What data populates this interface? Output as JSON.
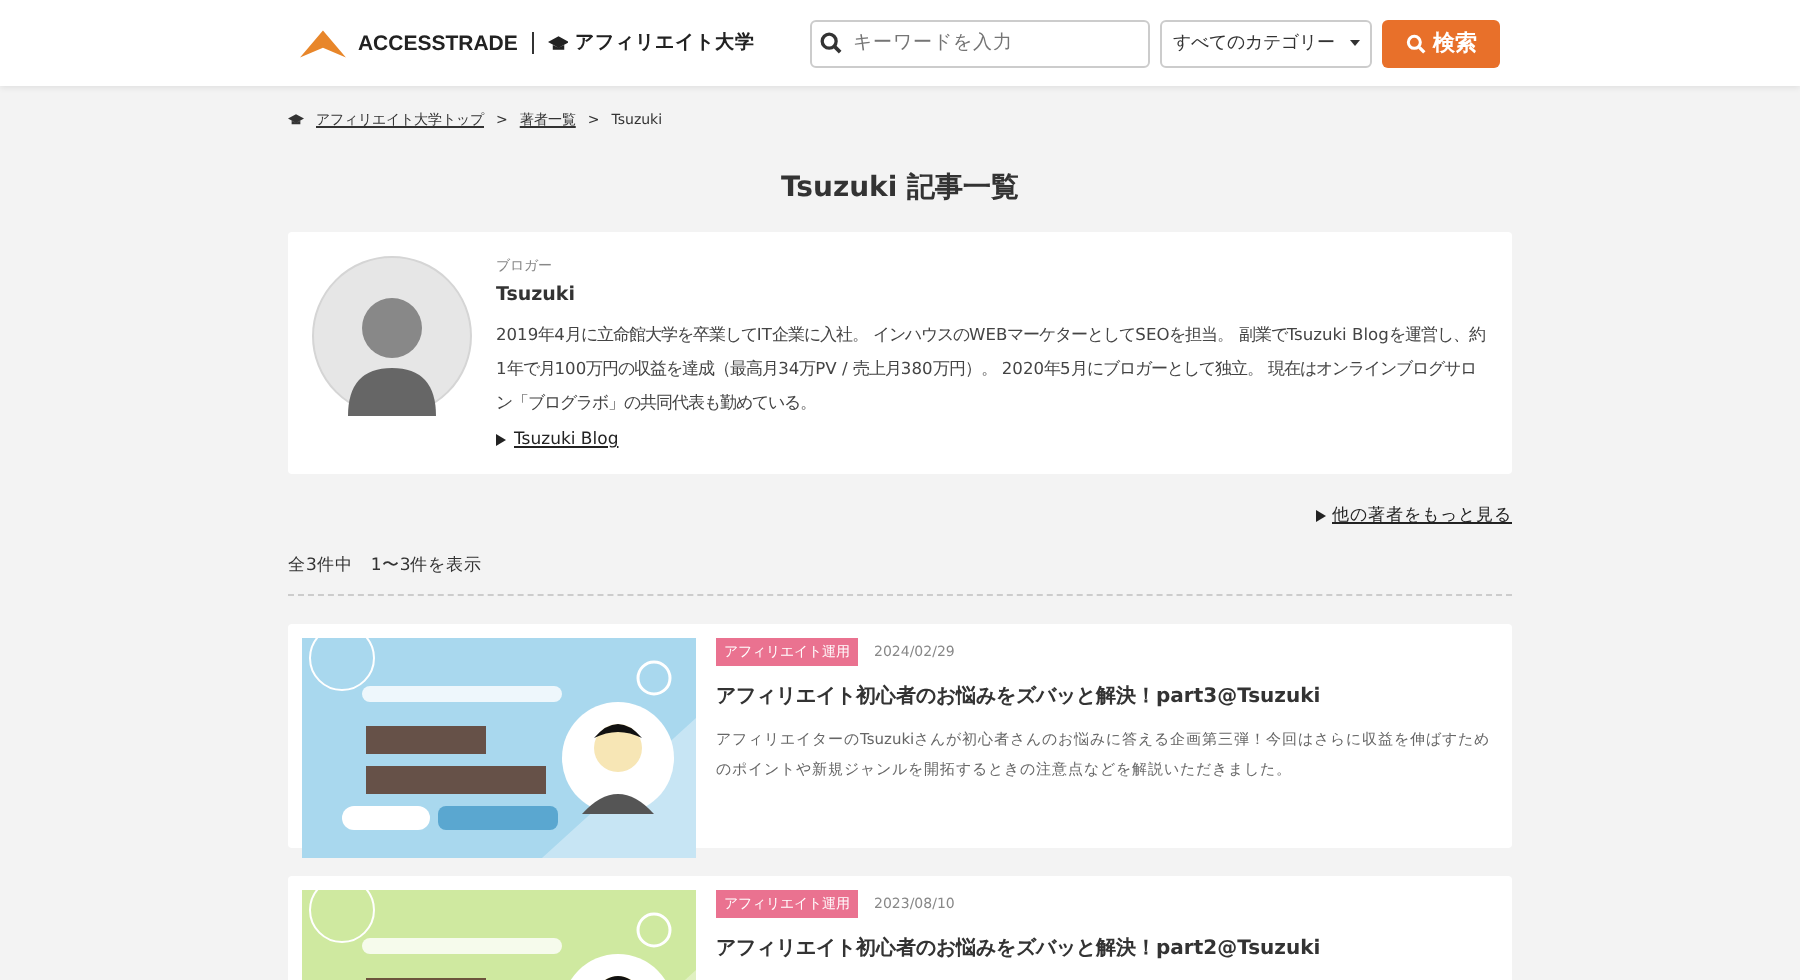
{
  "header": {
    "logo": "ACCESSTRADE",
    "site": "アフィリエイト大学",
    "search": {
      "placeholder": "キーワードを入力"
    },
    "category": {
      "value": "すべてのカテゴリー"
    },
    "search_button": "検索"
  },
  "breadcrumb": [
    "アフィリエイト大学トップ",
    "著者一覧",
    "Tsuzuki"
  ],
  "breadcrumb_separator": ">",
  "title": "Tsuzuki 記事一覧",
  "author": {
    "role": "ブロガー",
    "name": "Tsuzuki",
    "bio": "2019年4月に立命館大学を卒業してIT企業に入社。 インハウスのWEBマーケターとしてSEOを担当。 副業でTsuzuki Blogを運営し、約1年で月100万円の収益を達成（最高月34万PV / 売上月380万円）。 2020年5月にブロガーとして独立。 現在はオンラインブログサロン「ブログラボ」の共同代表も勤めている。",
    "link": "Tsuzuki Blog"
  },
  "more_authors": "他の著者をもっと見る",
  "count": "全3件中　1〜3件を表示",
  "articles": [
    {
      "tag": "アフィリエイト運用",
      "date": "2024/02/29",
      "title": "アフィリエイト初心者のお悩みをズバッと解決！part3@Tsuzuki",
      "summary": "アフィリエイターのTsuzukiさんが初心者さんのお悩みに答える企画第三弾！今回はさらに収益を伸ばすためのポイントや新規ジャンルを開拓するときの注意点などを解説いただきました。"
    },
    {
      "tag": "アフィリエイト運用",
      "date": "2023/08/10",
      "title": "アフィリエイト初心者のお悩みをズバッと解決！part2@Tsuzuki"
    }
  ]
}
